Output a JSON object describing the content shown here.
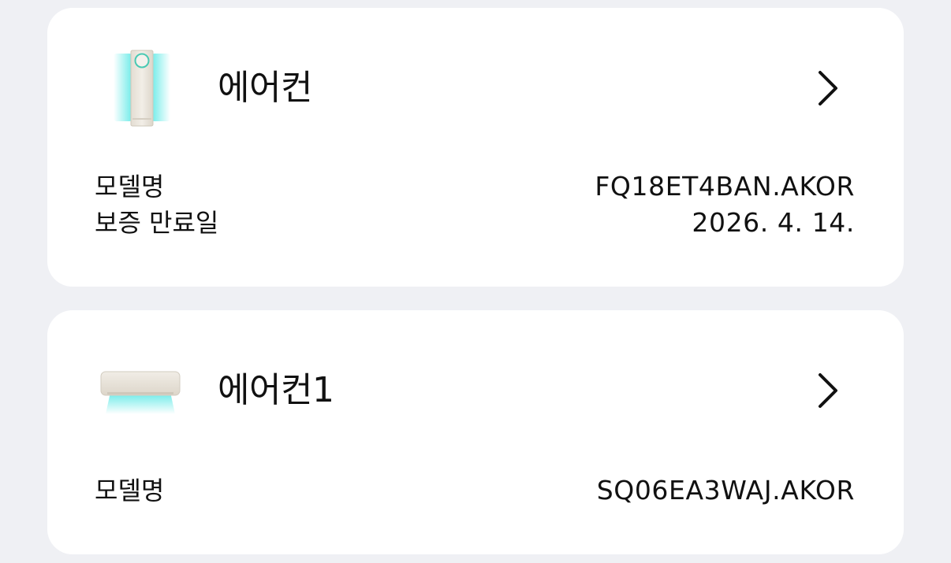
{
  "devices": [
    {
      "name": "에어컨",
      "icon": "standing-air-conditioner-icon",
      "rows": [
        {
          "label": "모델명",
          "value": "FQ18ET4BAN.AKOR"
        },
        {
          "label": "보증 만료일",
          "value": "2026. 4. 14."
        }
      ]
    },
    {
      "name": "에어컨1",
      "icon": "wall-air-conditioner-icon",
      "rows": [
        {
          "label": "모델명",
          "value": "SQ06EA3WAJ.AKOR"
        }
      ]
    }
  ],
  "colors": {
    "background": "#eff0f4",
    "card": "#ffffff",
    "text": "#111111",
    "airflow": "#5ee9e6",
    "device_body": "#ece7dd"
  }
}
